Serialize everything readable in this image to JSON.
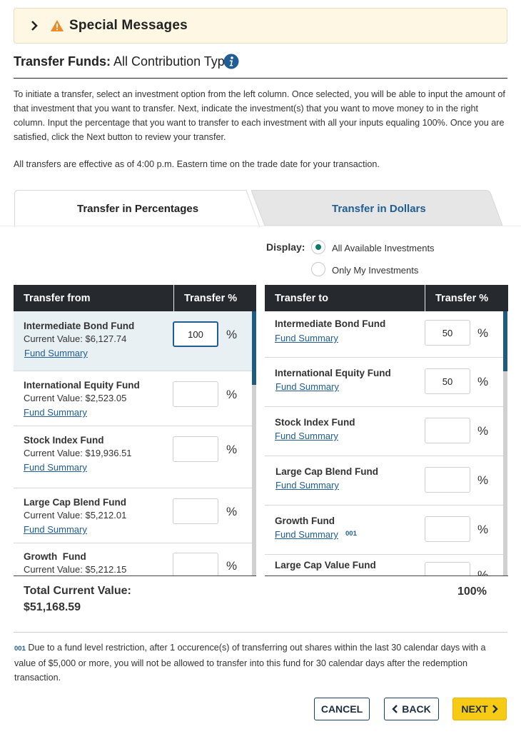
{
  "special_messages": {
    "title": "Special Messages"
  },
  "header": {
    "title_bold": "Transfer Funds:",
    "title_rest": " All Contribution Types"
  },
  "intro_text": "To initiate a transfer, select an investment option from the left column. Once selected, you will be able to input the amount of that investment that you want to transfer. Next, indicate the investment(s) that you want to move money to in the right column. Input the percentage that you want to transfer to each investment with all your inputs equaling 100%. Once you are satisfied, click the Next button to review your transfer.",
  "effective_text": "All transfers are effective as of 4:00 p.m. Eastern time on the trade date for your transaction.",
  "tabs": [
    {
      "label": "Transfer in Percentages",
      "active": true
    },
    {
      "label": "Transfer in Dollars",
      "active": false
    }
  ],
  "display": {
    "label": "Display:",
    "options": [
      {
        "label": "All Available Investments",
        "selected": true
      },
      {
        "label": "Only My Investments",
        "selected": false
      }
    ]
  },
  "transfer_from": {
    "col1": "Transfer from",
    "col2": "Transfer %",
    "rows": [
      {
        "name": "Intermediate Bond Fund",
        "value": "Current Value: $6,127.74",
        "link": "Fund Summary",
        "input": "100"
      },
      {
        "name": "International Equity Fund",
        "value": "Current Value: $2,523.05",
        "link": "Fund Summary",
        "input": ""
      },
      {
        "name": "Stock Index Fund",
        "value": "Current Value: $19,936.51",
        "link": "Fund Summary",
        "input": ""
      },
      {
        "name": "Large Cap Blend Fund",
        "value": "Current Value: $5,212.01",
        "link": "Fund Summary",
        "input": ""
      },
      {
        "name": "Growth  Fund",
        "value": "Current Value: $5,212.15",
        "link": "",
        "input": ""
      }
    ]
  },
  "transfer_to": {
    "col1": "Transfer to",
    "col2": "Transfer %",
    "rows": [
      {
        "name": "Intermediate Bond Fund",
        "link": "Fund Summary",
        "footnote": "",
        "input": "50"
      },
      {
        "name": "International Equity Fund",
        "link": "Fund Summary",
        "footnote": "",
        "input": "50"
      },
      {
        "name": "Stock Index Fund",
        "link": "Fund Summary",
        "footnote": "",
        "input": ""
      },
      {
        "name": "Large Cap Blend Fund",
        "link": "Fund Summary",
        "footnote": "",
        "input": ""
      },
      {
        "name": "Growth Fund",
        "link": "Fund Summary",
        "footnote": "001",
        "input": ""
      },
      {
        "name": "Large Cap Value Fund",
        "link": "",
        "footnote": "",
        "input": ""
      }
    ]
  },
  "pct_symbol": "%",
  "totals": {
    "label": "Total Current Value:",
    "value": "$51,168.59",
    "percent": "100%"
  },
  "footnote": {
    "code": "001",
    "text": " Due to a fund level restriction, after 1 occurence(s) of transferring out shares within the last 30 calendar days with a value of $5,000 or more, you will not be allowed to transfer into this fund for 30 calendar days after the redemption transaction."
  },
  "buttons": {
    "cancel": "CANCEL",
    "back": "BACK",
    "next": "NEXT"
  },
  "colors": {
    "accent_blue": "#1f5d93",
    "header_dark": "#262a2e",
    "next_yellow": "#f7cb15",
    "warning_orange": "#f08a24",
    "radio_green": "#0e7a6b"
  }
}
